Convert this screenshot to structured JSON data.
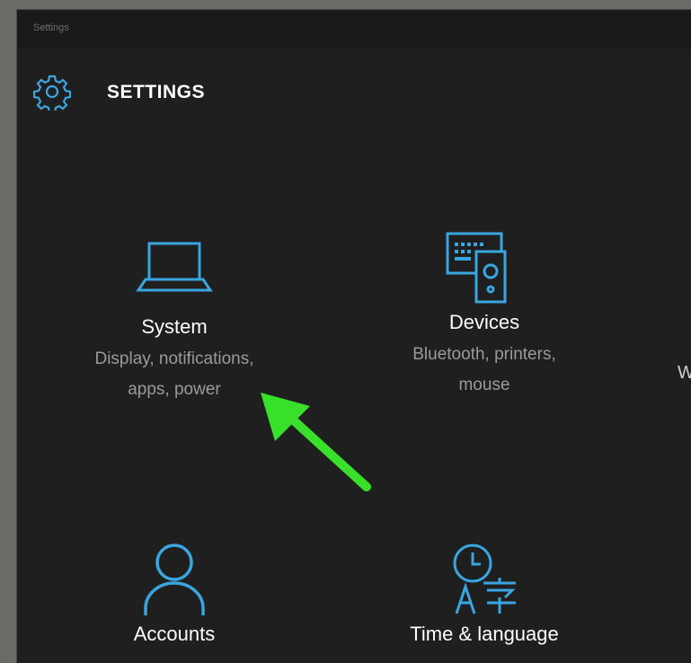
{
  "window": {
    "title": "Settings"
  },
  "header": {
    "title": "SETTINGS",
    "icon": "gear-icon"
  },
  "tiles": [
    {
      "id": "system",
      "title": "System",
      "desc1": "Display, notifications,",
      "desc2": "apps, power",
      "icon": "laptop-icon"
    },
    {
      "id": "devices",
      "title": "Devices",
      "desc1": "Bluetooth, printers,",
      "desc2": "mouse",
      "icon": "devices-icon"
    },
    {
      "id": "accounts",
      "title": "Accounts",
      "icon": "person-icon"
    },
    {
      "id": "time-language",
      "title": "Time & language",
      "icon": "time-language-icon"
    }
  ],
  "clipped": {
    "text": "W"
  },
  "colors": {
    "accent": "#3aa6e0",
    "arrow": "#38e02a",
    "background": "#1f1f1f"
  }
}
